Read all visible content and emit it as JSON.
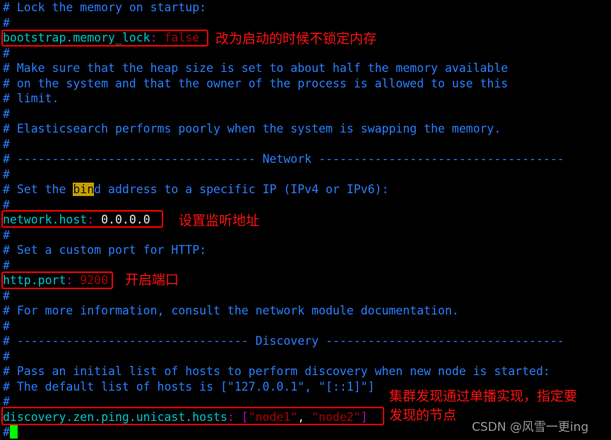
{
  "terminal": {
    "background": "#000000",
    "comment_color": "#2a7fff",
    "key_color": "#00c8c8",
    "punct_color": "#c000c0",
    "value_color": "#b00000",
    "plain_color": "#e8e8e8",
    "highlight_bg": "#c8a000",
    "annotation_color": "#ff1111",
    "box_color": "#ff0000",
    "cursor_color": "#00ff00",
    "file": "elasticsearch.yml"
  },
  "lines": [
    {
      "n": 1,
      "text": "# Lock the memory on startup:"
    },
    {
      "n": 2,
      "text": "#"
    },
    {
      "n": 3,
      "text": "bootstrap.memory_lock: false"
    },
    {
      "n": 4,
      "text": "#"
    },
    {
      "n": 5,
      "text": "# Make sure that the heap size is set to about half the memory available"
    },
    {
      "n": 6,
      "text": "# on the system and that the owner of the process is allowed to use this"
    },
    {
      "n": 7,
      "text": "# limit."
    },
    {
      "n": 8,
      "text": "#"
    },
    {
      "n": 9,
      "text": "# Elasticsearch performs poorly when the system is swapping the memory."
    },
    {
      "n": 10,
      "text": "#"
    },
    {
      "n": 11,
      "text": "# ---------------------------------- Network -----------------------------------"
    },
    {
      "n": 12,
      "text": "#"
    },
    {
      "n": 13,
      "text": "# Set the bind address to a specific IP (IPv4 or IPv6):"
    },
    {
      "n": 14,
      "text": "#"
    },
    {
      "n": 15,
      "text": "network.host: 0.0.0.0"
    },
    {
      "n": 16,
      "text": "#"
    },
    {
      "n": 17,
      "text": "# Set a custom port for HTTP:"
    },
    {
      "n": 18,
      "text": "#"
    },
    {
      "n": 19,
      "text": "http.port: 9200"
    },
    {
      "n": 20,
      "text": "#"
    },
    {
      "n": 21,
      "text": "# For more information, consult the network module documentation."
    },
    {
      "n": 22,
      "text": "#"
    },
    {
      "n": 23,
      "text": "# --------------------------------- Discovery ----------------------------------"
    },
    {
      "n": 24,
      "text": "#"
    },
    {
      "n": 25,
      "text": "# Pass an initial list of hosts to perform discovery when new node is started:"
    },
    {
      "n": 26,
      "text": "# The default list of hosts is [\"127.0.0.1\", \"[::1]\"]"
    },
    {
      "n": 27,
      "text": "#"
    },
    {
      "n": 28,
      "text": "discovery.zen.ping.unicast.hosts: [\"node1\", \"node2\"]"
    },
    {
      "n": 29,
      "text": "#"
    }
  ],
  "code": {
    "l1_hash": "# ",
    "l1_text": "Lock the memory on startup:",
    "hash": "#",
    "bootstrap_key": "bootstrap.memory_lock",
    "bootstrap_colon": ":",
    "bootstrap_value": " false",
    "l5": "# Make sure that the heap size is set to about half the memory available",
    "l6": "# on the system and that the owner of the process is allowed to use this",
    "l7": "# limit.",
    "l9": "# Elasticsearch performs poorly when the system is swapping the memory.",
    "network_sep_left": "# ---------------------------------- ",
    "network_sep_label": "Network",
    "network_sep_right": " -----------------------------------",
    "bind_pre": "# Set the ",
    "bind_hl": "bin",
    "bind_post": "d address to a specific IP (IPv4 or IPv6):",
    "nethost_key": "network.host",
    "nethost_colon": ":",
    "nethost_value": " 0.0.0.0",
    "httpcomment": "# Set a custom port for HTTP:",
    "httpport_key": "http.port",
    "httpport_colon": ":",
    "httpport_value": " 9200",
    "moreinfo": "# For more information, consult the network module documentation.",
    "discovery_sep_left": "# --------------------------------- ",
    "discovery_sep_label": "Discovery",
    "discovery_sep_right": " ----------------------------------",
    "pass_initial": "# Pass an initial list of hosts to perform discovery when new node is started:",
    "default_list": "# The default list of hosts is [\"127.0.0.1\", \"[::1]\"]",
    "disc_key": "discovery.zen.ping.unicast.hosts",
    "disc_colon": ":",
    "disc_space": " ",
    "disc_open": "[",
    "disc_node1": "\"node1\"",
    "disc_comma": ",",
    "disc_node2": " \"node2\"",
    "disc_close": "]"
  },
  "annotations": [
    {
      "id": "memlock",
      "text": "改为启动的时候不锁定内存"
    },
    {
      "id": "nethost",
      "text": "设置监听地址"
    },
    {
      "id": "httpport",
      "text": "开启端口"
    },
    {
      "id": "discovery_l1",
      "text": "集群发现通过单播实现，指定要"
    },
    {
      "id": "discovery_l2",
      "text": "发现的节点"
    }
  ],
  "watermark": {
    "text": "CSDN @风雪一更ing"
  }
}
